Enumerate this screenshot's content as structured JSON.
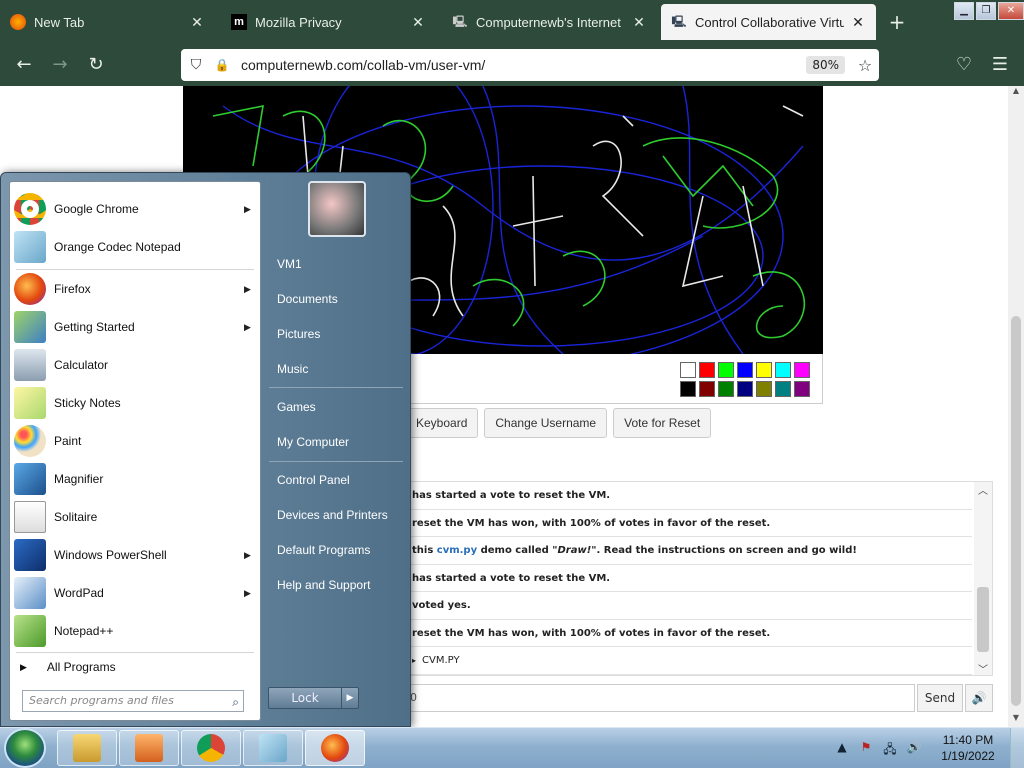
{
  "tabs": [
    {
      "label": "New Tab",
      "icon": "firefox-icon"
    },
    {
      "label": "Mozilla Privacy",
      "icon": "mozilla-m-icon"
    },
    {
      "label": "Computernewb's Internet Pub",
      "icon": "computer-icon"
    },
    {
      "label": "Control Collaborative Virtual M",
      "icon": "computer-icon",
      "active": true
    }
  ],
  "address": {
    "url": "computernewb.com/collab-vm/user-vm/",
    "zoom": "80%"
  },
  "palette": [
    "#ffffff",
    "#ff0000",
    "#00ff00",
    "#0000ff",
    "#ffff00",
    "#00ffff",
    "#ff00ff",
    "#000000",
    "#800000",
    "#008000",
    "#000080",
    "#808000",
    "#008080",
    "#800080"
  ],
  "buttons": {
    "keyboard": "Keyboard",
    "change_username": "Change Username",
    "vote_reset": "Vote for Reset"
  },
  "chat": {
    "messages": [
      "has started a vote to reset the VM.",
      "reset the VM has won, with 100% of votes in favor of the reset.",
      {
        "pre": "this ",
        "link": "cvm.py",
        "mid": " demo called ",
        "em": "\"Draw!\"",
        "post": ". Read the instructions on screen and go wild!"
      },
      "has started a vote to reset the VM.",
      "voted yes.",
      "reset the VM has won, with 100% of votes in favor of the reset.",
      "CVM.PY"
    ],
    "input_prefix": "0",
    "send": "Send"
  },
  "start_menu": {
    "programs": [
      {
        "label": "Google Chrome",
        "submenu": true
      },
      {
        "label": "Orange Codec Notepad",
        "submenu": false
      },
      {
        "label": "Firefox",
        "submenu": true
      },
      {
        "label": "Getting Started",
        "submenu": true
      },
      {
        "label": "Calculator",
        "submenu": false
      },
      {
        "label": "Sticky Notes",
        "submenu": false
      },
      {
        "label": "Paint",
        "submenu": false
      },
      {
        "label": "Magnifier",
        "submenu": false
      },
      {
        "label": "Solitaire",
        "submenu": false
      },
      {
        "label": "Windows PowerShell",
        "submenu": true
      },
      {
        "label": "WordPad",
        "submenu": true
      },
      {
        "label": "Notepad++",
        "submenu": false
      }
    ],
    "all_programs": "All Programs",
    "search_placeholder": "Search programs and files",
    "right_items": [
      "VM1",
      "Documents",
      "Pictures",
      "Music",
      "Games",
      "My Computer",
      "Control Panel",
      "Devices and Printers",
      "Default Programs",
      "Help and Support"
    ],
    "lock": "Lock"
  },
  "taskbar": {
    "time": "11:40 PM",
    "date": "1/19/2022"
  }
}
